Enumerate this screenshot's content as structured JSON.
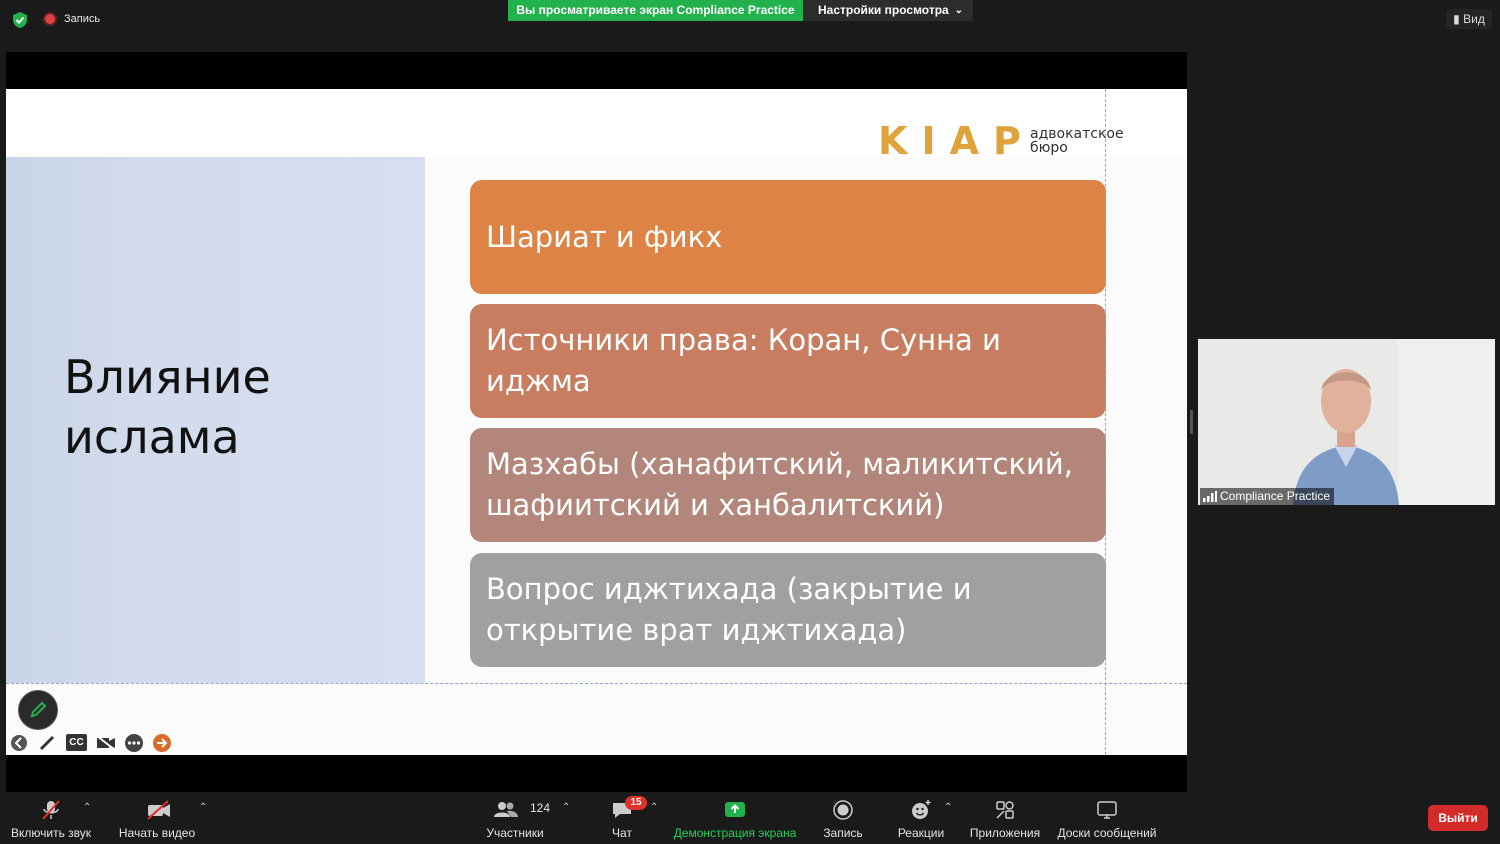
{
  "top": {
    "recording_label": "Запись",
    "share_banner": "Вы просматриваете экран Compliance Practice",
    "view_settings_label": "Настройки просмотра",
    "view_label": "Вид"
  },
  "slide": {
    "title_line1": "Влияние",
    "title_line2": "ислама",
    "logo_letters": "KIAP",
    "logo_text_line1": "адвокатское",
    "logo_text_line2": "бюро",
    "boxes": [
      {
        "text": "Шариат и фикх"
      },
      {
        "text": "Источники права: Коран, Сунна и иджма"
      },
      {
        "text": "Мазхабы (ханафитский, маликитский, шафиитский и ханбалитский)"
      },
      {
        "text": "Вопрос иджтихада (закрытие и открытие врат иджтихада)"
      }
    ],
    "cc_label": "CC"
  },
  "video": {
    "participant_name": "Compliance Practice"
  },
  "toolbar": {
    "mute_label": "Включить звук",
    "video_label": "Начать видео",
    "participants_label": "Участники",
    "participants_count": "124",
    "chat_label": "Чат",
    "chat_badge": "15",
    "share_label": "Демонстрация экрана",
    "record_label": "Запись",
    "reactions_label": "Реакции",
    "apps_label": "Приложения",
    "whiteboards_label": "Доски сообщений",
    "leave_label": "Выйти"
  },
  "colors": {
    "share_green": "#23b14d",
    "box1": "#de8346",
    "box2": "#c87d60",
    "box3": "#b2867a",
    "box4": "#a0a0a0",
    "leave_red": "#d32a2a",
    "logo_gold": "#e0a23a"
  }
}
